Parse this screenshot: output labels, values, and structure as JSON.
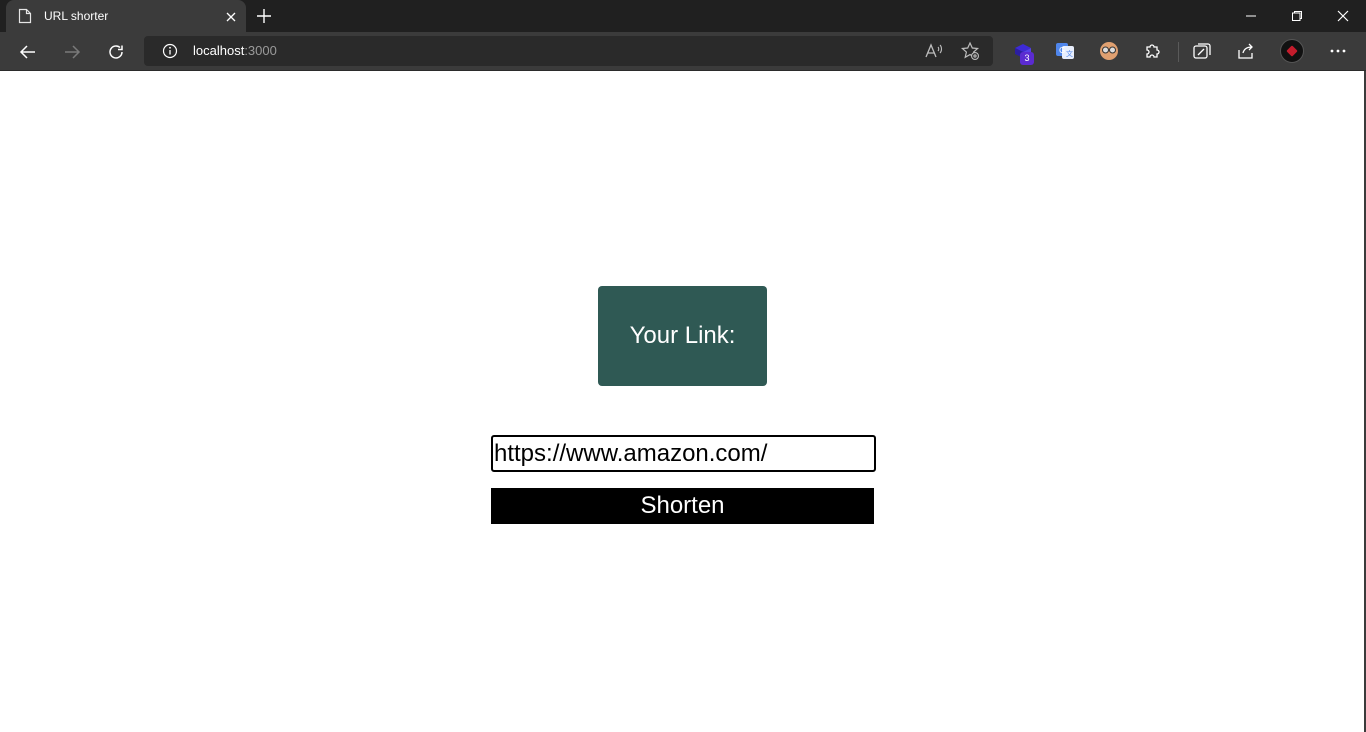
{
  "browser": {
    "tab": {
      "title": "URL shorter",
      "icon": "page-icon"
    },
    "address_bar": {
      "host": "localhost",
      "port": ":3000"
    },
    "extensions_badge": "3",
    "icons": [
      "back-arrow-icon",
      "forward-arrow-icon",
      "reload-icon",
      "site-info-icon",
      "read-aloud-icon",
      "add-favorite-icon",
      "extension-icon",
      "translate-icon",
      "glasses-extension-icon",
      "puzzle-extensions-icon",
      "collections-icon",
      "share-icon",
      "profile-avatar",
      "more-options-icon"
    ]
  },
  "page": {
    "link_box_label": "Your Link:",
    "url_input_value": "https://www.amazon.com/",
    "shorten_label": "Shorten"
  },
  "colors": {
    "link_box_bg": "#2f5954",
    "button_bg": "#000000",
    "chrome_dark": "#202020",
    "toolbar": "#3b3b3b"
  }
}
